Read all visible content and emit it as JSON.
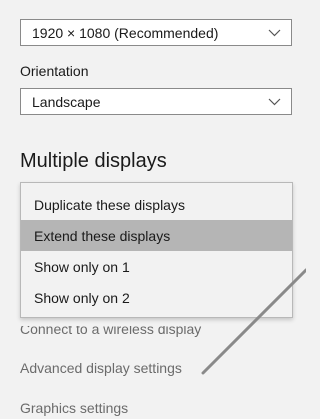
{
  "resolution": {
    "value": "1920 × 1080 (Recommended)",
    "icon": "chevron-down-icon"
  },
  "orientation": {
    "label": "Orientation",
    "value": "Landscape",
    "icon": "chevron-down-icon"
  },
  "multiple_displays": {
    "heading": "Multiple displays",
    "options": [
      {
        "label": "Duplicate these displays",
        "selected": false
      },
      {
        "label": "Extend these displays",
        "selected": true
      },
      {
        "label": "Show only on 1",
        "selected": false
      },
      {
        "label": "Show only on 2",
        "selected": false
      }
    ]
  },
  "links": {
    "wireless": "Connect to a wireless display",
    "advanced": "Advanced display settings",
    "graphics": "Graphics settings"
  },
  "colors": {
    "background": "#f2f2f2",
    "selected_item": "#b5b5b5",
    "link_text": "#6b6b6b",
    "annotation_line": "#8a8a8a"
  }
}
